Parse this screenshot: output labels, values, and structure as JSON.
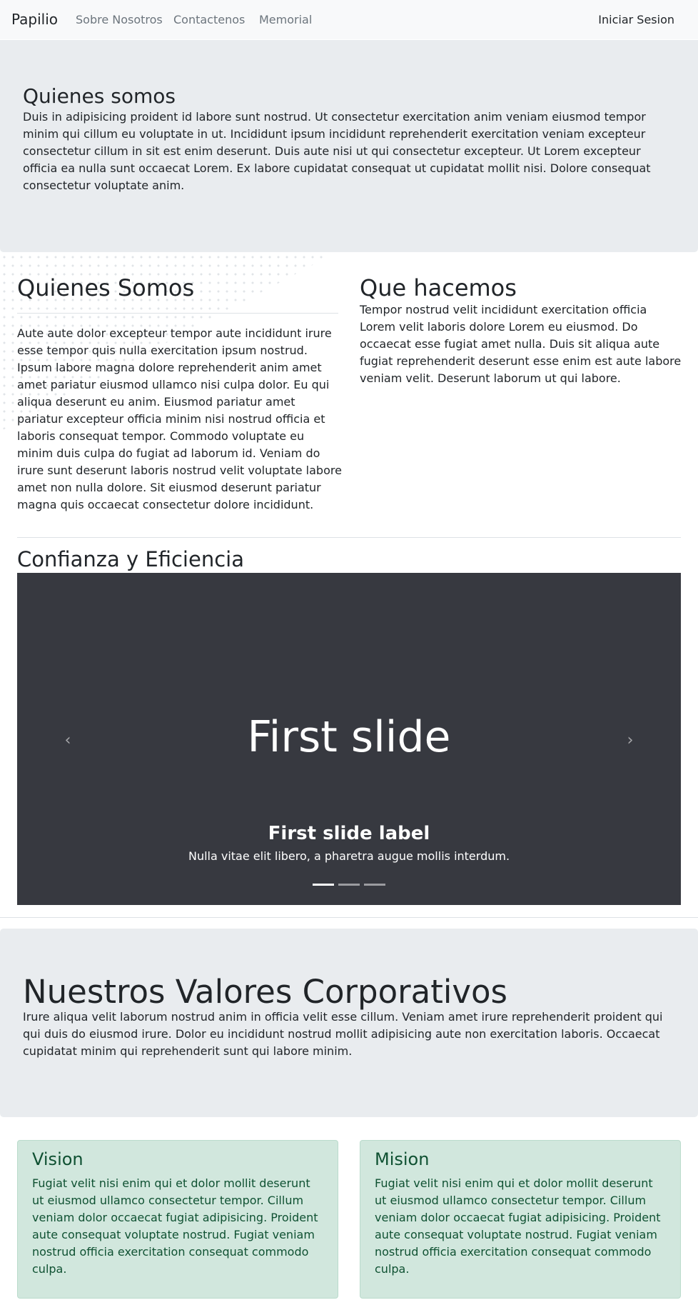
{
  "navbar": {
    "brand": "Papilio",
    "links": [
      "Sobre Nosotros",
      "Contactenos",
      "Memorial"
    ],
    "login": "Iniciar Sesion"
  },
  "hero": {
    "title": "Quienes somos",
    "text": "Duis in adipisicing proident id labore sunt nostrud. Ut consectetur exercitation anim veniam eiusmod tempor minim qui cillum eu voluptate in ut. Incididunt ipsum incididunt reprehenderit exercitation veniam excepteur consectetur cillum in sit est enim deserunt. Duis aute nisi ut qui consectetur excepteur. Ut Lorem excepteur officia ea nulla sunt occaecat Lorem. Ex labore cupidatat consequat ut cupidatat mollit nisi. Dolore consequat consectetur voluptate anim."
  },
  "about": {
    "title": "Quienes Somos",
    "text": "Aute aute dolor excepteur tempor aute incididunt irure esse tempor quis nulla exercitation ipsum nostrud. Ipsum labore magna dolore reprehenderit anim amet amet pariatur eiusmod ullamco nisi culpa dolor. Eu qui aliqua deserunt eu anim. Eiusmod pariatur amet pariatur excepteur officia minim nisi nostrud officia et laboris consequat tempor. Commodo voluptate eu minim duis culpa do fugiat ad laborum id. Veniam do irure sunt deserunt laboris nostrud velit voluptate labore amet non nulla dolore. Sit eiusmod deserunt pariatur magna quis occaecat consectetur dolore incididunt."
  },
  "what": {
    "title": "Que hacemos",
    "text": "Tempor nostrud velit incididunt exercitation officia Lorem velit laboris dolore Lorem eu eiusmod. Do occaecat esse fugiat amet nulla. Duis sit aliqua aute fugiat reprehenderit deserunt esse enim est aute labore veniam velit. Deserunt laborum ut qui labore."
  },
  "carousel": {
    "title": "Confianza y Eficiencia",
    "slide_text": "First slide",
    "caption_title": "First slide label",
    "caption_text": "Nulla vitae elit libero, a pharetra augue mollis interdum.",
    "prev_icon": "‹",
    "next_icon": "›",
    "active_index": 0,
    "indicator_count": 3,
    "background": "#373940"
  },
  "values": {
    "title": "Nuestros Valores Corporativos",
    "text": "Irure aliqua velit laborum nostrud anim in officia velit esse cillum. Veniam amet irure reprehenderit proident qui qui duis do eiusmod irure. Dolor eu incididunt nostrud mollit adipisicing aute non exercitation laboris. Occaecat cupidatat minim qui reprehenderit sunt qui labore minim."
  },
  "cards": {
    "vision": {
      "title": "Vision",
      "text": "Fugiat velit nisi enim qui et dolor mollit deserunt ut eiusmod ullamco consectetur tempor. Cillum veniam dolor occaecat fugiat adipisicing. Proident aute consequat voluptate nostrud. Fugiat veniam nostrud officia exercitation consequat commodo culpa."
    },
    "mision": {
      "title": "Mision",
      "text": "Fugiat velit nisi enim qui et dolor mollit deserunt ut eiusmod ullamco consectetur tempor. Cillum veniam dolor occaecat fugiat adipisicing. Proident aute consequat voluptate nostrud. Fugiat veniam nostrud officia exercitation consequat commodo culpa."
    },
    "color": "#0f5132",
    "background": "#d1e7dd"
  }
}
